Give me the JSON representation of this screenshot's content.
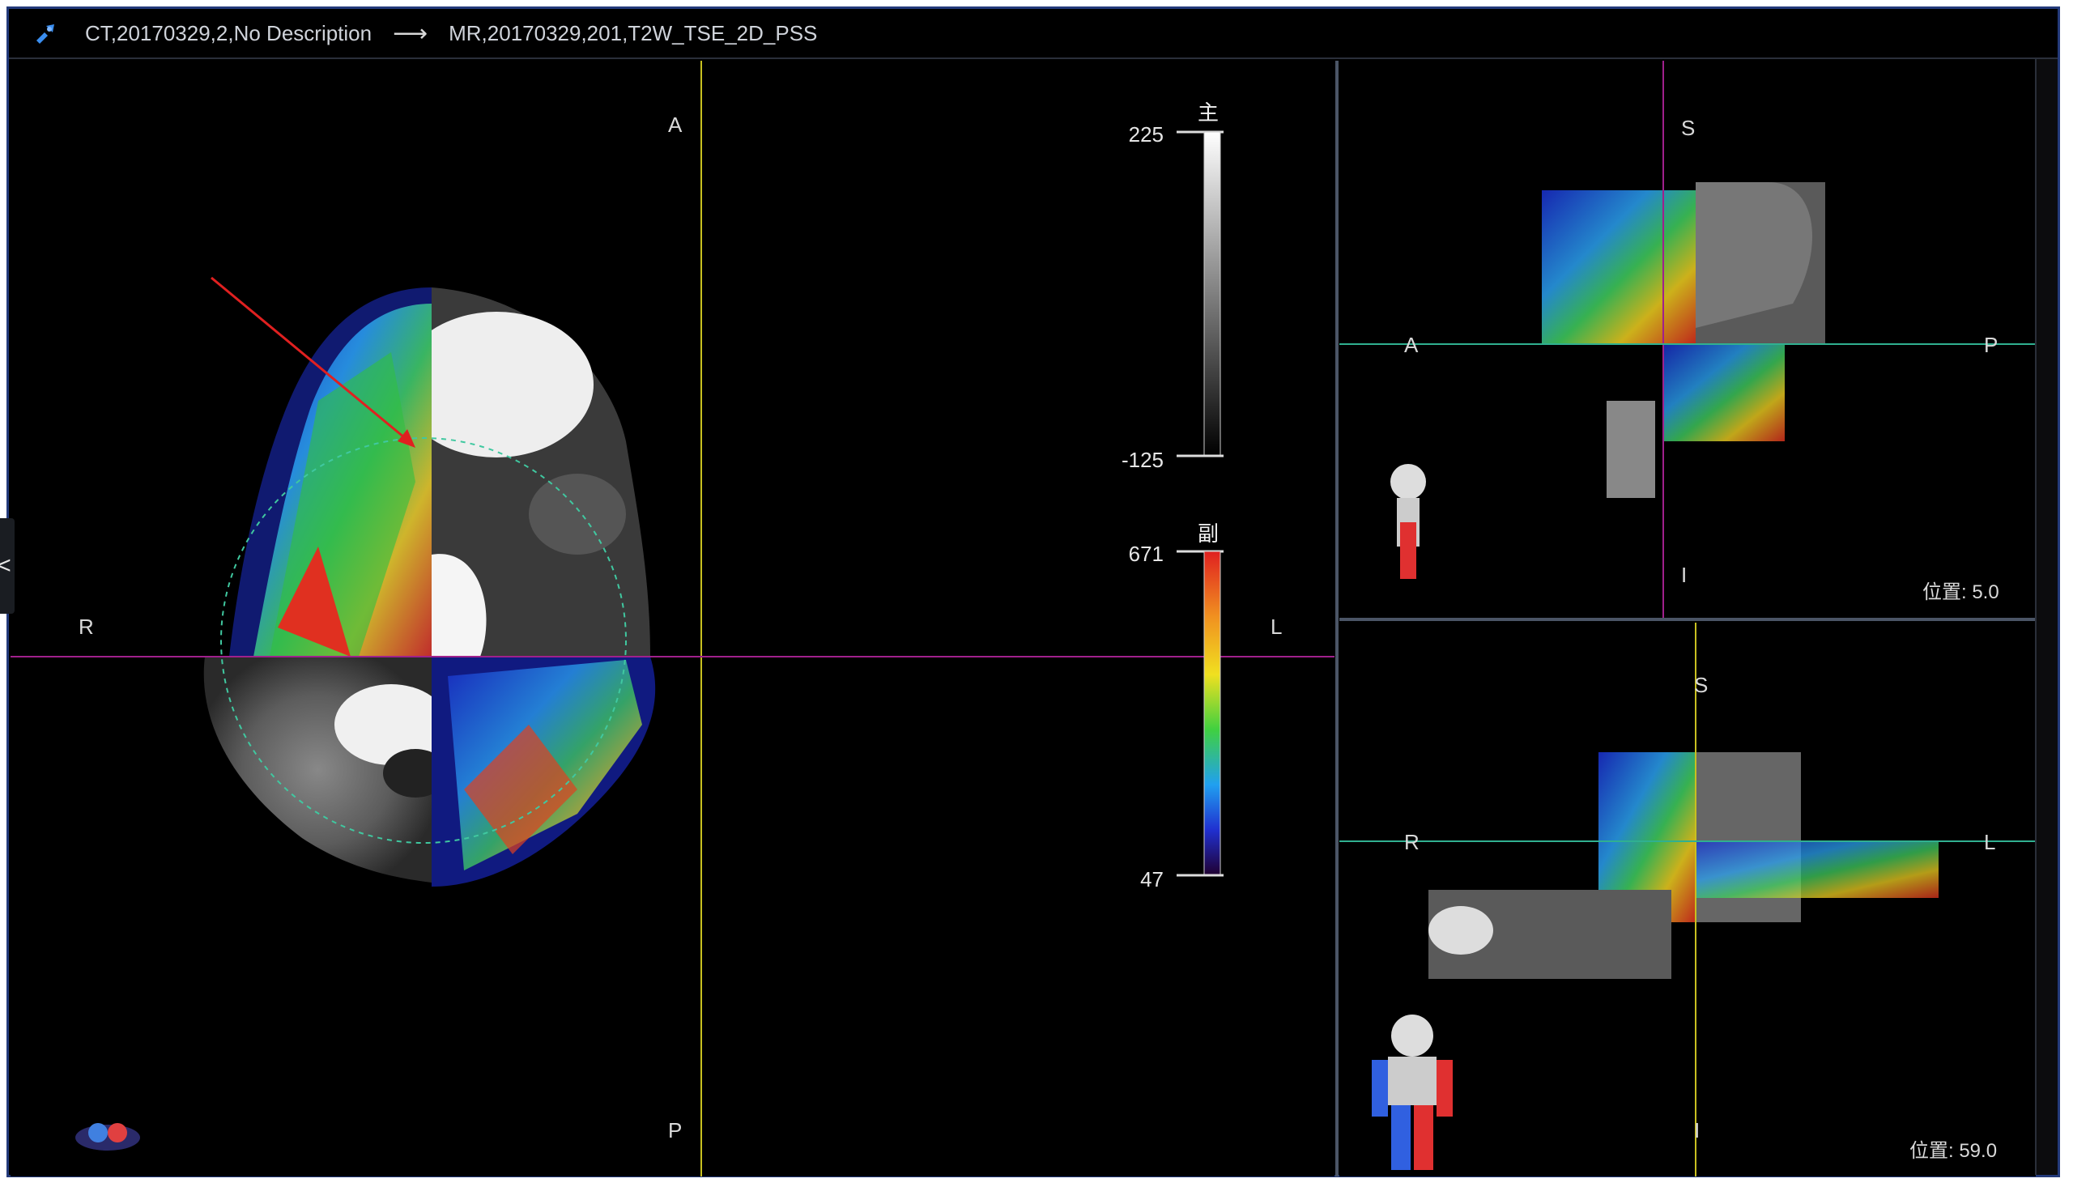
{
  "titlebar": {
    "fixed_series": "CT,20170329,2,No Description",
    "arrow": "⟶",
    "moving_series": "MR,20170329,201,T2W_TSE_2D_PSS",
    "icon": "registration-icon"
  },
  "main_view": {
    "orientation": {
      "top": "A",
      "bottom": "P",
      "left": "R",
      "right": "L"
    },
    "primary_scale": {
      "title": "主",
      "max": "225",
      "min": "-125"
    },
    "secondary_scale": {
      "title": "副",
      "max": "671",
      "min": "47"
    },
    "crosshair_colors": {
      "vertical": "#c8c020",
      "horizontal": "#a0208c"
    }
  },
  "sagittal_view": {
    "orientation": {
      "top": "S",
      "bottom": "I",
      "left": "A",
      "right": "P"
    },
    "position_label": "位置: 5.0"
  },
  "coronal_view": {
    "orientation": {
      "top": "S",
      "bottom": "I",
      "left": "R",
      "right": "L"
    },
    "position_label": "位置: 59.0"
  },
  "sidebar": {
    "collapse_glyph": "<"
  }
}
